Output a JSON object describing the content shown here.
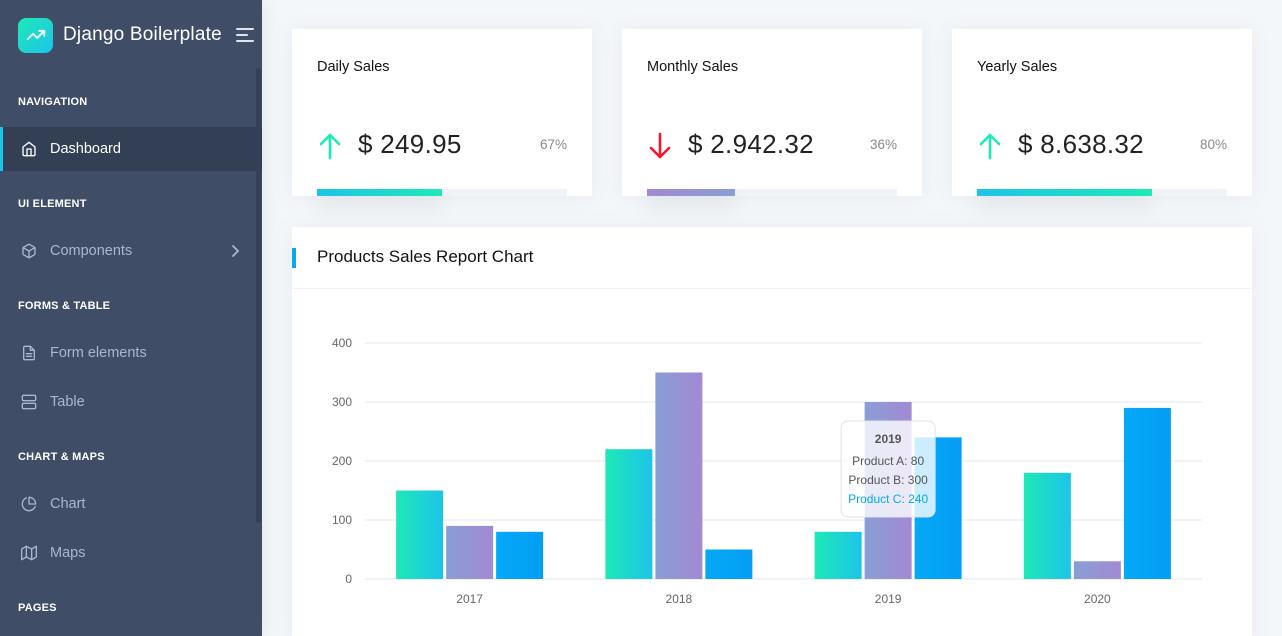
{
  "brand": {
    "name": "Django Boilerplate"
  },
  "sidebar": {
    "captions": [
      "NAVIGATION",
      "UI ELEMENT",
      "FORMS & TABLE",
      "CHART & MAPS",
      "PAGES"
    ],
    "items": [
      {
        "label": "Dashboard",
        "icon": "home-icon"
      },
      {
        "label": "Components",
        "icon": "box-icon"
      },
      {
        "label": "Form elements",
        "icon": "file-text-icon"
      },
      {
        "label": "Table",
        "icon": "server-icon"
      },
      {
        "label": "Chart",
        "icon": "pie-chart-icon"
      },
      {
        "label": "Maps",
        "icon": "map-icon"
      }
    ]
  },
  "stats": [
    {
      "title": "Daily Sales",
      "value": "$ 249.95",
      "percent": "67%",
      "progress": 0.5,
      "trend": "up",
      "color": "#1de9b6"
    },
    {
      "title": "Monthly Sales",
      "value": "$ 2.942.32",
      "percent": "36%",
      "progress": 0.35,
      "trend": "down",
      "color": "#f44236"
    },
    {
      "title": "Yearly Sales",
      "value": "$ 8.638.32",
      "percent": "80%",
      "progress": 0.7,
      "trend": "up",
      "color": "#1de9b6"
    }
  ],
  "chart_card": {
    "title": "Products Sales Report Chart"
  },
  "chart_data": {
    "type": "bar",
    "categories": [
      "2017",
      "2018",
      "2019",
      "2020"
    ],
    "series": [
      {
        "name": "Product A",
        "values": [
          150,
          220,
          80,
          180
        ],
        "color": "#1de9b6"
      },
      {
        "name": "Product B",
        "values": [
          90,
          350,
          300,
          30
        ],
        "color": "#a389d4"
      },
      {
        "name": "Product C",
        "values": [
          80,
          50,
          240,
          290
        ],
        "color": "#04a9f5"
      }
    ],
    "y_ticks": [
      "0",
      "100",
      "200",
      "300",
      "400"
    ],
    "ylim": [
      0,
      400
    ],
    "grid": true,
    "tooltip": {
      "title": "2019",
      "lines": [
        "Product A: 80",
        "Product B: 300",
        "Product C: 240"
      ]
    }
  }
}
